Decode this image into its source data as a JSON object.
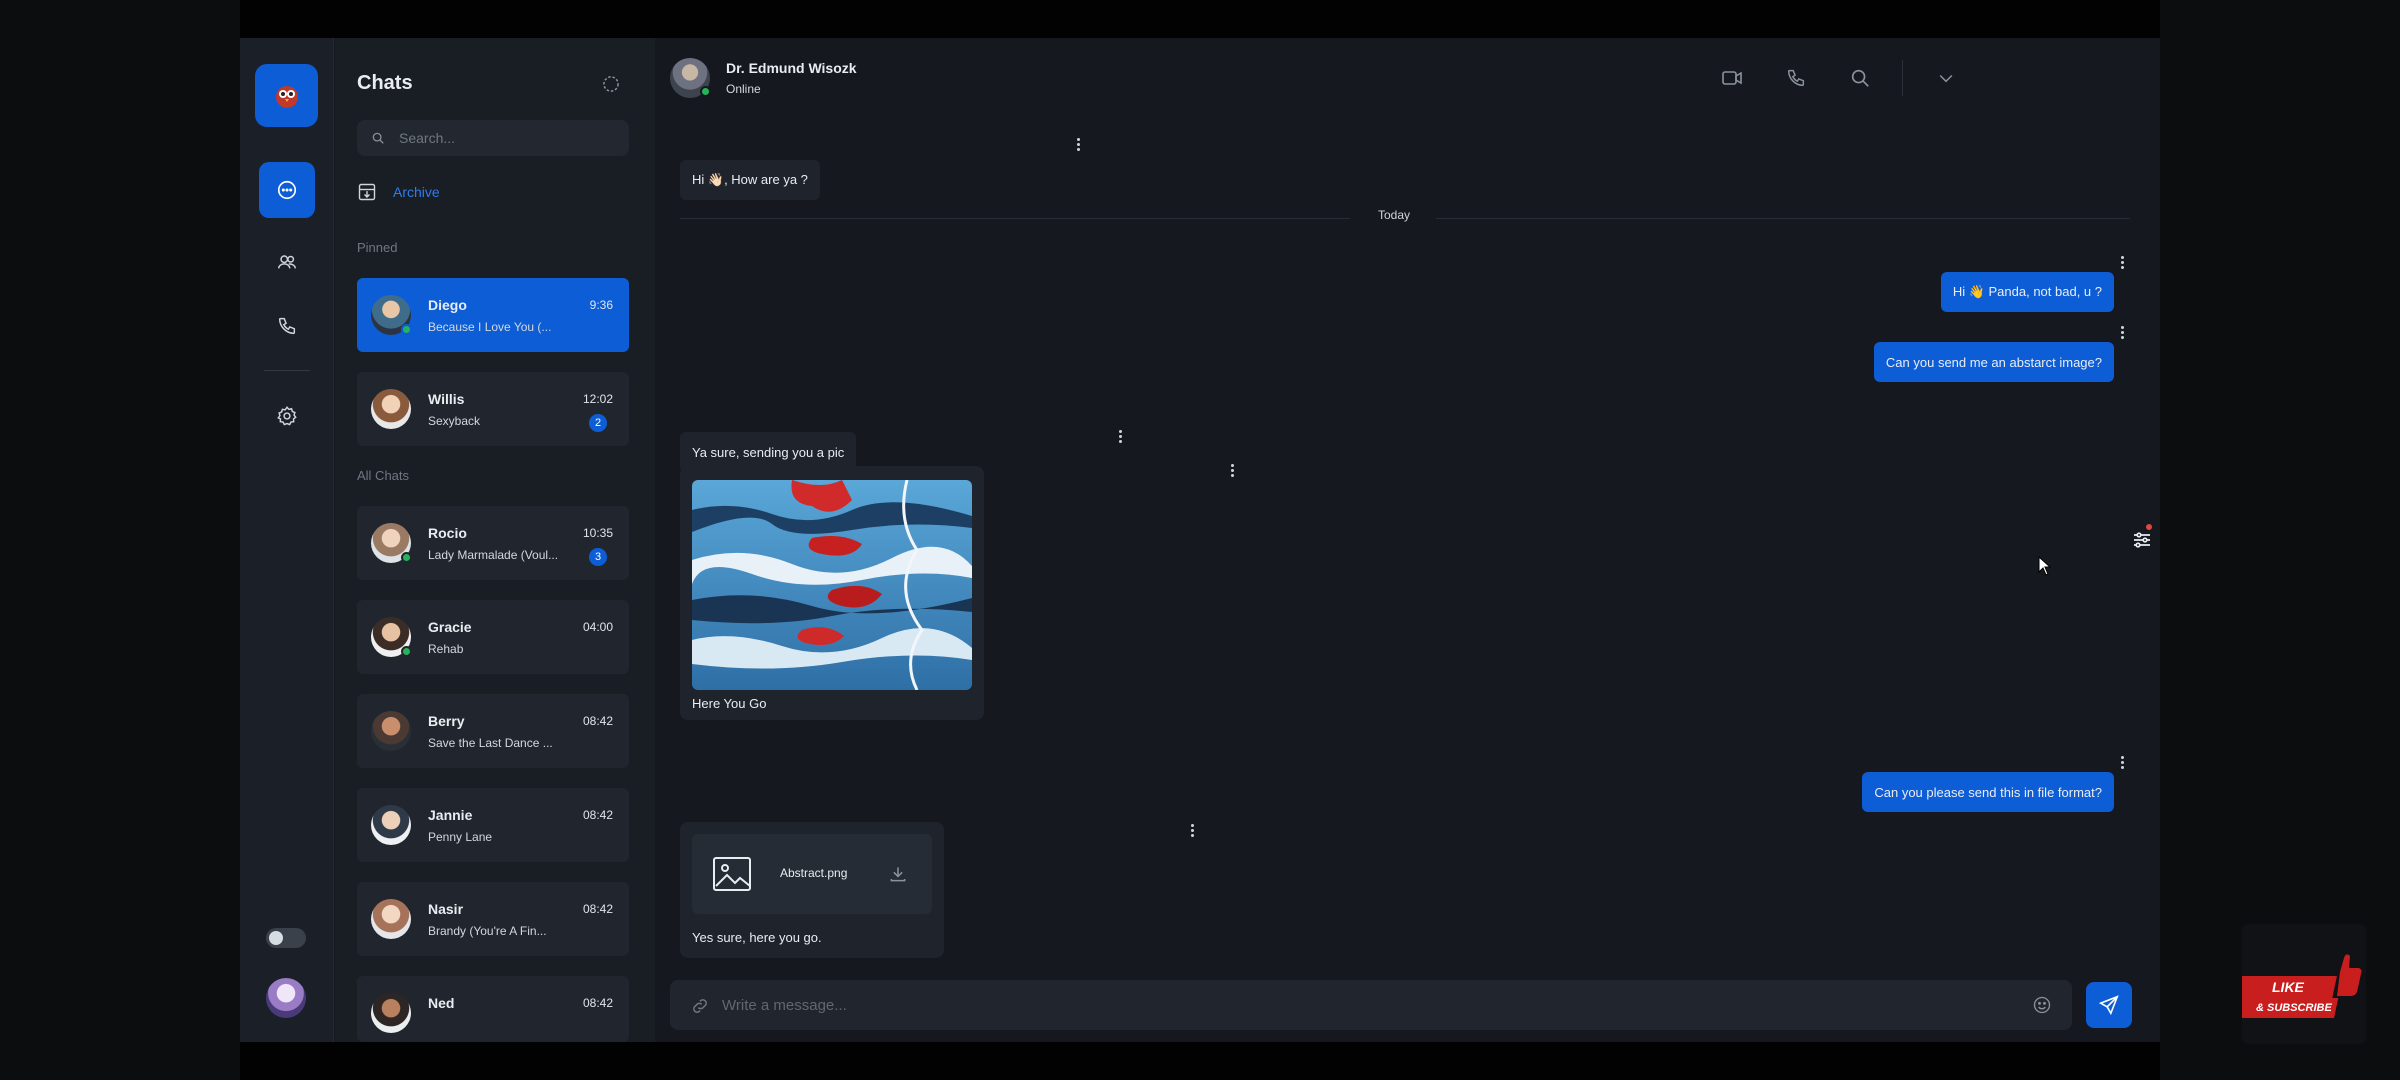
{
  "nav": {
    "items": [
      "chats",
      "contacts",
      "calls",
      "settings"
    ]
  },
  "list": {
    "title": "Chats",
    "search_placeholder": "Search...",
    "archive_label": "Archive",
    "pinned_label": "Pinned",
    "all_label": "All Chats",
    "pinned": [
      {
        "name": "Diego",
        "preview": "Because I Love You (...",
        "time": "9:36",
        "badge": "",
        "online": true,
        "active": true
      },
      {
        "name": "Willis",
        "preview": "Sexyback",
        "time": "12:02",
        "badge": "2",
        "online": false,
        "active": false
      }
    ],
    "all": [
      {
        "name": "Rocio",
        "preview": "Lady Marmalade (Voul...",
        "time": "10:35",
        "badge": "3",
        "online": true
      },
      {
        "name": "Gracie",
        "preview": "Rehab",
        "time": "04:00",
        "badge": "",
        "online": true
      },
      {
        "name": "Berry",
        "preview": "Save the Last Dance ...",
        "time": "08:42",
        "badge": "",
        "online": false
      },
      {
        "name": "Jannie",
        "preview": "Penny Lane",
        "time": "08:42",
        "badge": "",
        "online": false
      },
      {
        "name": "Nasir",
        "preview": "Brandy (You're A Fin...",
        "time": "08:42",
        "badge": "",
        "online": false
      },
      {
        "name": "Ned",
        "preview": "",
        "time": "08:42",
        "badge": "",
        "online": false
      }
    ]
  },
  "conversation": {
    "contact_name": "Dr. Edmund Wisozk",
    "contact_status": "Online",
    "day_label": "Today",
    "messages": {
      "m1": "Hi 👋🏻, How are ya ?",
      "m2": "Hi 👋 Panda, not bad, u ?",
      "m3": "Can you send me an abstarct image?",
      "m4": "Ya sure, sending you a pic",
      "m5_caption": "Here You Go",
      "m6": "Can you please send this in file format?",
      "m7_file": "Abstract.png",
      "m7_caption": "Yes sure, here you go."
    },
    "composer_placeholder": "Write a message..."
  },
  "watermark": {
    "line1": "LIKE",
    "line2": "& SUBSCRIBE"
  },
  "colors": {
    "accent": "#0d5dd6",
    "online": "#27b35a",
    "background": "#15191f"
  }
}
